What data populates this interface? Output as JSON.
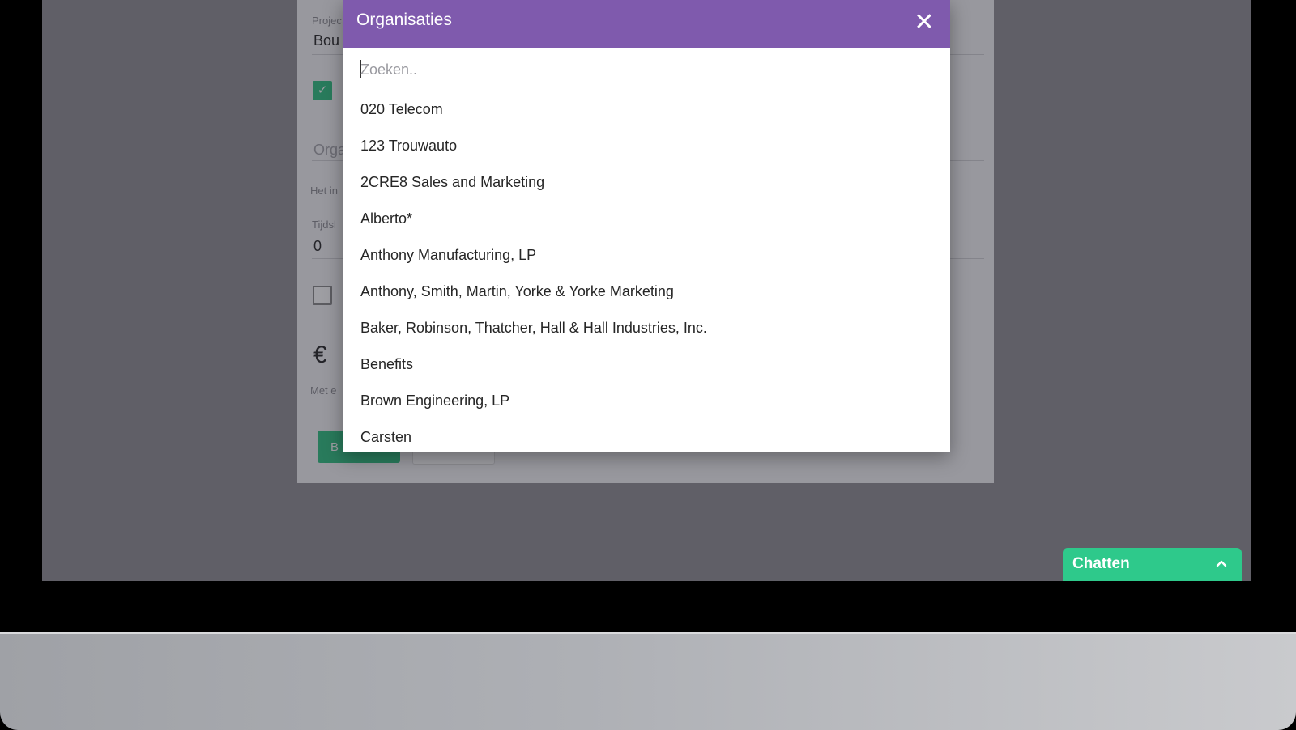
{
  "background_form": {
    "project_label": "Projec",
    "project_value": "Bou",
    "organisation_placeholder": "Orga",
    "hint_text": "Het in",
    "time_label": "Tijdsl",
    "time_value": "0",
    "currency_symbol": "€",
    "price_hint": "Met e",
    "primary_button_label": "B"
  },
  "modal": {
    "title": "Organisaties",
    "close_symbol": "✕",
    "search": {
      "placeholder": "Zoeken..",
      "value": ""
    },
    "organisations": [
      "020 Telecom",
      "123 Trouwauto",
      "2CRE8 Sales and Marketing",
      "Alberto*",
      "Anthony Manufacturing, LP",
      "Anthony, Smith, Martin, Yorke & Yorke Marketing",
      "Baker, Robinson, Thatcher, Hall & Hall Industries, Inc.",
      "Benefits",
      "Brown Engineering, LP",
      "Carsten"
    ]
  },
  "chat": {
    "label": "Chatten",
    "icon": "chevron-up-icon"
  },
  "colors": {
    "modal_header": "#7f5aad",
    "chat_green": "#2ec98b",
    "checkbox_green": "#2bbf7e"
  }
}
